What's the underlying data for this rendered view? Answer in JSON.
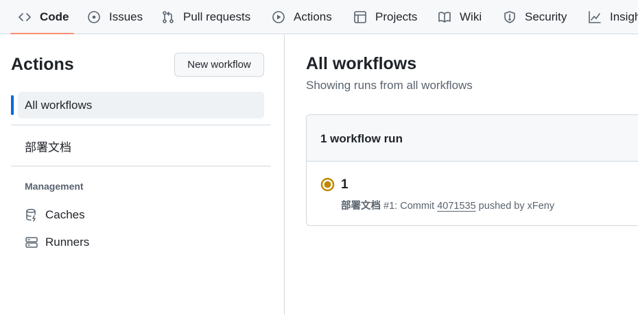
{
  "nav": {
    "tabs": [
      {
        "label": "Code",
        "icon": "code-icon",
        "active": true
      },
      {
        "label": "Issues",
        "icon": "issue-opened-icon"
      },
      {
        "label": "Pull requests",
        "icon": "git-pull-request-icon"
      },
      {
        "label": "Actions",
        "icon": "play-icon"
      },
      {
        "label": "Projects",
        "icon": "table-icon"
      },
      {
        "label": "Wiki",
        "icon": "book-icon"
      },
      {
        "label": "Security",
        "icon": "shield-icon"
      },
      {
        "label": "Insights",
        "icon": "graph-icon"
      }
    ],
    "underline_color": "#fd8c73"
  },
  "sidebar": {
    "title": "Actions",
    "new_workflow_label": "New workflow",
    "workflows": [
      {
        "label": "All workflows",
        "active": true
      },
      {
        "label": "部署文档"
      }
    ],
    "management_heading": "Management",
    "management_items": [
      {
        "label": "Caches",
        "icon": "database-icon"
      },
      {
        "label": "Runners",
        "icon": "server-icon"
      }
    ],
    "accent_color": "#0969da"
  },
  "main": {
    "title": "All workflows",
    "subtitle": "Showing runs from all workflows",
    "runs_count_label": "1 workflow run",
    "runs": [
      {
        "title": "1",
        "status": "in-progress",
        "status_color": "#bf8700",
        "workflow_name": "部署文档",
        "run_number": "#1",
        "event_prefix": ": Commit ",
        "commit_sha": "4071535",
        "pushed_by_text": " pushed by xFeny"
      }
    ]
  }
}
